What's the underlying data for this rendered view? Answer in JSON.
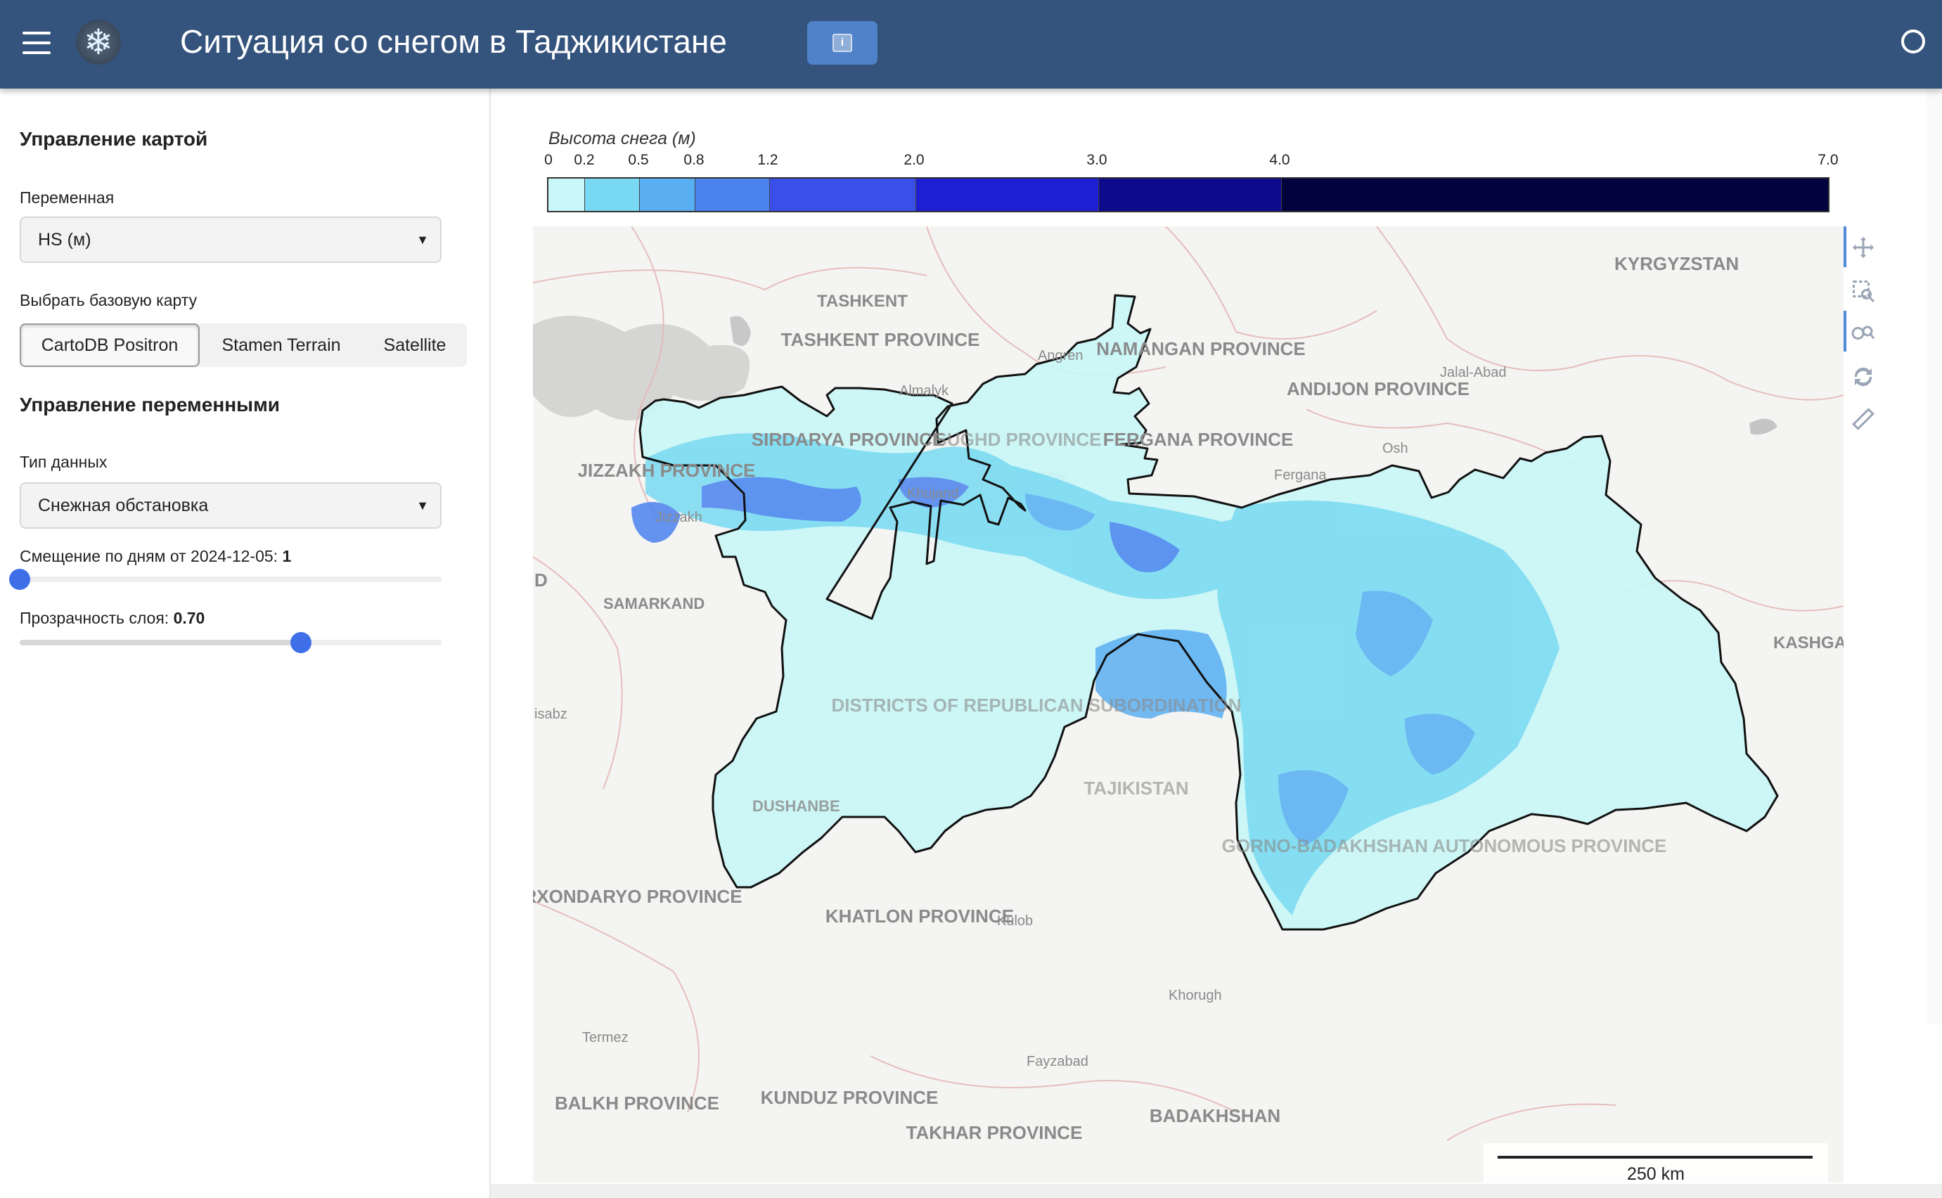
{
  "header": {
    "title": "Ситуация со снегом в Таджикистане",
    "info_button": "i"
  },
  "sidebar": {
    "map_controls_title": "Управление картой",
    "variable_label": "Переменная",
    "variable_value": "HS (м)",
    "basemap_label": "Выбрать базовую карту",
    "basemaps": [
      "CartoDB Positron",
      "Stamen Terrain",
      "Satellite"
    ],
    "basemap_selected": "CartoDB Positron",
    "variables_title": "Управление переменными",
    "data_type_label": "Тип данных",
    "data_type_value": "Снежная обстановка",
    "day_offset_label": "Смещение по дням от 2024-12-05:",
    "day_offset_value": "1",
    "day_offset_fraction": 0.0,
    "opacity_label": "Прозрачность слоя:",
    "opacity_value": "0.70",
    "opacity_fraction": 0.667
  },
  "legend": {
    "title": "Высота снега (м)",
    "ticks": [
      "0",
      "0.2",
      "0.5",
      "0.8",
      "1.2",
      "2.0",
      "3.0",
      "4.0",
      "7.0"
    ],
    "bins": [
      {
        "from": 0,
        "to": 0.2,
        "color": "#c9f6f6"
      },
      {
        "from": 0.2,
        "to": 0.5,
        "color": "#79d9f2"
      },
      {
        "from": 0.5,
        "to": 0.8,
        "color": "#5aaef2"
      },
      {
        "from": 0.8,
        "to": 1.2,
        "color": "#4a83ee"
      },
      {
        "from": 1.2,
        "to": 2.0,
        "color": "#3a4fe8"
      },
      {
        "from": 2.0,
        "to": 3.0,
        "color": "#1c1fd2"
      },
      {
        "from": 3.0,
        "to": 4.0,
        "color": "#0f0a8c"
      },
      {
        "from": 4.0,
        "to": 7.0,
        "color": "#02023f"
      }
    ]
  },
  "map": {
    "labels": [
      "KYRGYZSTAN",
      "TASHKENT",
      "TASHKENT PROVINCE",
      "Angren",
      "Almalyk",
      "NAMANGAN PROVINCE",
      "ANDIJON PROVINCE",
      "Jalal-Abad",
      "Osh",
      "FERGANA PROVINCE",
      "Fergana",
      "SIRDARYA PROVINCE",
      "SUGHD PROVINCE",
      "JIZZAKH PROVINCE",
      "Jizzakh",
      "Khujand",
      "SAMARKAND",
      "D",
      "KASHGA",
      "isabz",
      "DISTRICTS OF REPUBLICAN SUBORDINATION",
      "TAJIKISTAN",
      "DUSHANBE",
      "GORNO-BADAKHSHAN AUTONOMOUS PROVINCE",
      "SURXONDARYO PROVINCE",
      "KHATLON PROVINCE",
      "Kulob",
      "Khorugh",
      "Termez",
      "Fayzabad",
      "BALKH PROVINCE",
      "KUNDUZ PROVINCE",
      "TAKHAR PROVINCE",
      "BADAKHSHAN"
    ],
    "scale_label": "250 km"
  },
  "toolbar": [
    "pan-tool",
    "box-zoom-tool",
    "wheel-zoom-tool",
    "reset-tool",
    "measure-tool"
  ]
}
